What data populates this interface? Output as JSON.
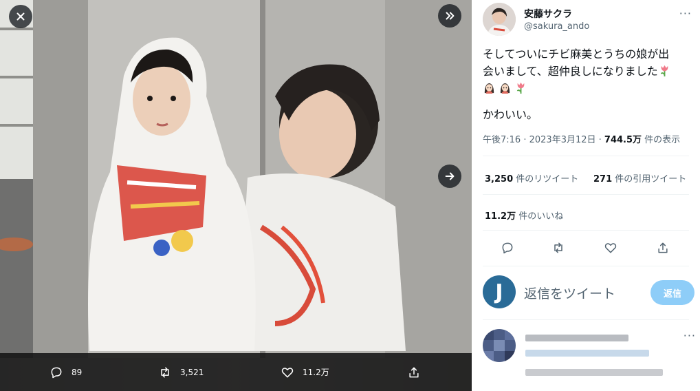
{
  "media": {
    "close_icon": "close-icon",
    "expand_icon": "double-chevron-right-icon",
    "next_icon": "arrow-right-icon"
  },
  "media_actions": {
    "reply_count": "89",
    "retweet_count": "3,521",
    "like_count": "11.2万"
  },
  "author": {
    "name": "安藤サクラ",
    "handle": "@sakura_ando"
  },
  "tweet": {
    "line1": "そしてついにチビ麻美とうちの娘が出",
    "line2": "会いまして、超仲良しになりました",
    "line4": "かわいい。",
    "emoji": [
      "tulip",
      "woman",
      "woman",
      "tulip"
    ]
  },
  "meta": {
    "time": "午後7:16",
    "sep1": " · ",
    "date": "2023年3月12日",
    "sep2": " · ",
    "views": "744.5万",
    "views_suffix": " 件の表示"
  },
  "stats": {
    "retweets": "3,250",
    "retweets_label": " 件のリツイート",
    "quotes": "271",
    "quotes_label": " 件の引用ツイート",
    "likes": "11.2万",
    "likes_label": " 件のいいね"
  },
  "reply": {
    "avatar_letter": "J",
    "placeholder": "返信をツイート",
    "button": "返信"
  },
  "colors": {
    "accent": "#1d9bf0",
    "reply_button": "#8ecdf8",
    "muted": "#536471"
  }
}
